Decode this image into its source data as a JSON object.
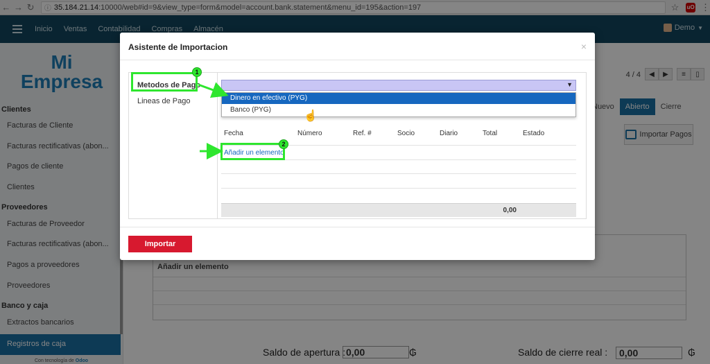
{
  "browser": {
    "url_host": "35.184.21.14",
    "url_rest": ":10000/web#id=9&view_type=form&model=account.bank.statement&menu_id=195&action=197",
    "ext_label": "uO"
  },
  "topnav": {
    "items": [
      "Inicio",
      "Ventas",
      "Contabilidad",
      "Compras",
      "Almacén"
    ],
    "user": "Demo"
  },
  "sidebar": {
    "logo_line1": "Mi",
    "logo_line2": "Empresa",
    "sections": {
      "clientes": "Clientes",
      "proveedores": "Proveedores",
      "banco": "Banco y caja"
    },
    "links": {
      "facturas_cliente": "Facturas de Cliente",
      "rect_cliente": "Facturas rectificativas (abon...",
      "pagos_cliente": "Pagos de cliente",
      "clientes": "Clientes",
      "facturas_proveedor": "Facturas de Proveedor",
      "rect_proveedor": "Facturas rectificativas (abon...",
      "pagos_proveedores": "Pagos a proveedores",
      "proveedores": "Proveedores",
      "extractos": "Extractos bancarios",
      "registros": "Registros de caja"
    },
    "powered_prefix": "Con tecnología de",
    "powered_brand": "Odoo"
  },
  "main": {
    "pager": "4 / 4",
    "status": [
      "Nuevo",
      "Abierto",
      "Cierre"
    ],
    "import_pagos": "Importar Pagos",
    "bg_add": "Añadir un elemento",
    "saldo_apertura_label": "Saldo de apertura :",
    "saldo_apertura_value": "0,00",
    "saldo_cierre_label": "Saldo de cierre real :",
    "saldo_cierre_value": "0,00",
    "currency": "₲"
  },
  "modal": {
    "title": "Asistente de Importacion",
    "close": "×",
    "tabs": [
      "Metodos de Pago",
      "Lineas de Pago"
    ],
    "dropdown_options": [
      "Dinero en efectivo (PYG)",
      "Banco (PYG)"
    ],
    "columns": [
      "Fecha",
      "Número",
      "Ref. #",
      "Socio",
      "Diario",
      "Total",
      "Estado"
    ],
    "add_element": "Añadir un elemento",
    "total": "0,00",
    "import_button": "Importar"
  },
  "annotations": {
    "badge1": "1",
    "badge2": "2",
    "color": "#2ee62e"
  }
}
